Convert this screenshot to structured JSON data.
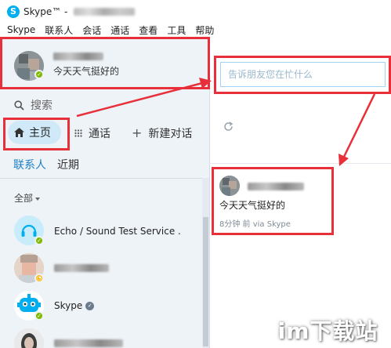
{
  "window": {
    "title": "Skype™ -"
  },
  "menu": [
    "Skype",
    "联系人",
    "会话",
    "通话",
    "查看",
    "工具",
    "帮助"
  ],
  "profile": {
    "mood": "今天天气挺好的"
  },
  "search": {
    "label": "搜索"
  },
  "nav": {
    "home": "主页",
    "calls": "通话",
    "new_chat": "新建对话"
  },
  "tabs": {
    "contacts": "联系人",
    "recent": "近期"
  },
  "filter": {
    "label": "全部"
  },
  "contacts": [
    {
      "name": "Echo / Sound Test Service .",
      "status": "online"
    },
    {
      "name": "",
      "status": "away"
    },
    {
      "name": "Skype",
      "status": "online",
      "verified": true
    },
    {
      "name": "",
      "status": "online"
    }
  ],
  "status_input": {
    "placeholder": "告诉朋友您在忙什么"
  },
  "feed": {
    "mood": "今天天气挺好的",
    "meta": "8分钟 前 via Skype"
  },
  "watermark": "im下载站",
  "colors": {
    "accent": "#00aff0",
    "highlight": "#e7303a",
    "online": "#7fba00",
    "away": "#fdb913",
    "home_pill": "#cfe9f8"
  }
}
